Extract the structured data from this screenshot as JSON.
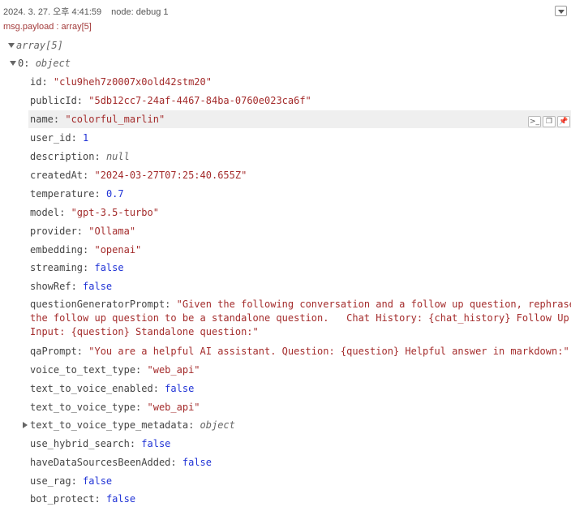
{
  "header": {
    "timestamp": "2024. 3. 27. 오후 4:41:59",
    "node": "node: debug 1",
    "topic": "msg.payload : array[5]"
  },
  "tree": {
    "root_label": "array[5]",
    "item_index": "0",
    "item_type": "object",
    "fields": [
      {
        "key": "id",
        "value": "\"clu9heh7z0007x0old42stm20\""
      },
      {
        "key": "publicId",
        "value": "\"5db12cc7-24af-4467-84ba-0760e023ca6f\""
      },
      {
        "key": "name",
        "value": "\"colorful_marlin\""
      },
      {
        "key": "user_id",
        "value": "1"
      },
      {
        "key": "description",
        "value": "null"
      },
      {
        "key": "createdAt",
        "value": "\"2024-03-27T07:25:40.655Z\""
      },
      {
        "key": "temperature",
        "value": "0.7"
      },
      {
        "key": "model",
        "value": "\"gpt-3.5-turbo\""
      },
      {
        "key": "provider",
        "value": "\"Ollama\""
      },
      {
        "key": "embedding",
        "value": "\"openai\""
      },
      {
        "key": "streaming",
        "value": "false"
      },
      {
        "key": "showRef",
        "value": "false"
      },
      {
        "key": "questionGeneratorPrompt",
        "value": "\"Given the following conversation and a follow up question, rephrase\nthe follow up question to be a standalone question.   Chat History: {chat_history} Follow Up\nInput: {question} Standalone question:\""
      },
      {
        "key": "qaPrompt",
        "value": "\"You are a helpful AI assistant.  Question: {question} Helpful answer in markdown:\""
      },
      {
        "key": "voice_to_text_type",
        "value": "\"web_api\""
      },
      {
        "key": "text_to_voice_enabled",
        "value": "false"
      },
      {
        "key": "text_to_voice_type",
        "value": "\"web_api\""
      },
      {
        "key": "text_to_voice_type_metadata",
        "value": "object"
      },
      {
        "key": "use_hybrid_search",
        "value": "false"
      },
      {
        "key": "haveDataSourcesBeenAdded",
        "value": "false"
      },
      {
        "key": "use_rag",
        "value": "false"
      },
      {
        "key": "bot_protect",
        "value": "false"
      }
    ]
  },
  "row_tools": [
    "copy-path",
    "copy-value",
    "pin"
  ],
  "colors": {
    "string": "#a42c2c",
    "number": "#2033d6",
    "topic": "#a33b3b"
  }
}
